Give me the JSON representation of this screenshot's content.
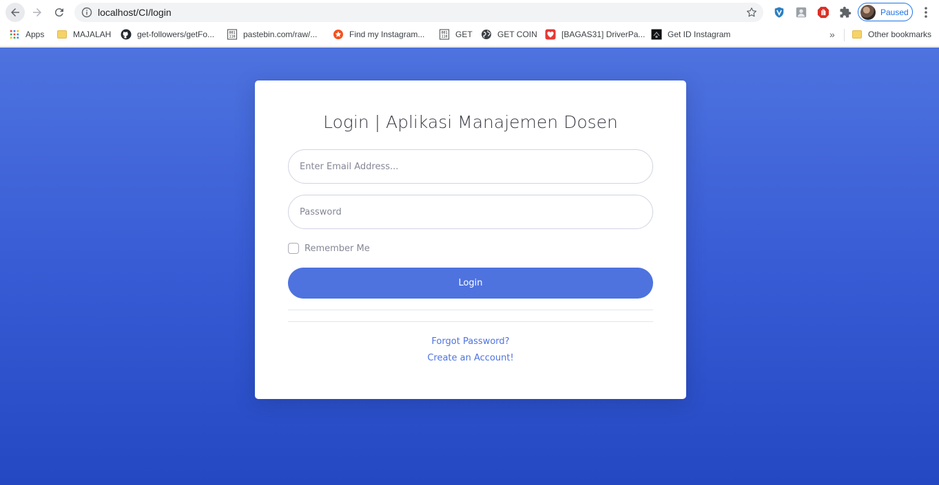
{
  "browser": {
    "url": "localhost/CI/login",
    "profile_status": "Paused",
    "bookmarks": [
      {
        "label": "Apps",
        "icon": "apps-grid-icon"
      },
      {
        "label": "MAJALAH",
        "icon": "folder-icon"
      },
      {
        "label": "get-followers/getFo...",
        "icon": "github-icon"
      },
      {
        "label": "pastebin.com/raw/...",
        "icon": "binary-file-icon"
      },
      {
        "label": "Find my Instagram...",
        "icon": "orange-star-icon"
      },
      {
        "label": "GET",
        "icon": "binary-file-icon"
      },
      {
        "label": "GET COIN",
        "icon": "globe-icon"
      },
      {
        "label": "[BAGAS31] DriverPa...",
        "icon": "heart-icon"
      },
      {
        "label": "Get ID Instagram",
        "icon": "dark-site-icon"
      }
    ],
    "other_bookmarks": "Other bookmarks",
    "overflow": "»"
  },
  "login": {
    "title": "Login | Aplikasi Manajemen Dosen",
    "email_placeholder": "Enter Email Address...",
    "password_placeholder": "Password",
    "remember_label": "Remember Me",
    "button_label": "Login",
    "forgot_link": "Forgot Password?",
    "create_link": "Create an Account!"
  },
  "colors": {
    "primary": "#4e73df",
    "background_top": "#4e73df",
    "background_bottom": "#2448c2",
    "profile_accent": "#1a73e8"
  }
}
